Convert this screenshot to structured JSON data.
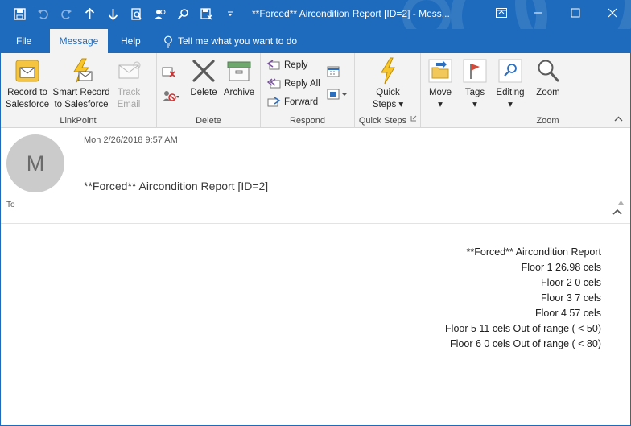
{
  "window": {
    "title": "**Forced** Aircondition Report  [ID=2]  -  Mess..."
  },
  "tabs": [
    {
      "label": "File"
    },
    {
      "label": "Message"
    },
    {
      "label": "Help"
    }
  ],
  "tell_me": "Tell me what you want to do",
  "ribbon": {
    "linkpoint": {
      "label": "LinkPoint",
      "record": [
        "Record to",
        "Salesforce"
      ],
      "smart": [
        "Smart Record",
        "to Salesforce"
      ],
      "track": [
        "Track",
        "Email"
      ]
    },
    "delete": {
      "label": "Delete",
      "delete_btn": "Delete",
      "archive_btn": "Archive"
    },
    "respond": {
      "label": "Respond",
      "reply": "Reply",
      "reply_all": "Reply All",
      "forward": "Forward"
    },
    "quicksteps": {
      "label": "Quick Steps",
      "btn": [
        "Quick",
        "Steps ▾"
      ]
    },
    "move": {
      "label": "Move"
    },
    "tags": {
      "label": "Tags"
    },
    "editing": {
      "label": "Editing"
    },
    "zoom": {
      "label": "Zoom",
      "btn": "Zoom"
    }
  },
  "message": {
    "avatar_initial": "M",
    "date": "Mon 2/26/2018 9:57 AM",
    "subject": "**Forced** Aircondition Report  [ID=2]",
    "to_label": "To",
    "body_lines": [
      "**Forced** Aircondition Report",
      "Floor 1 26.98 cels",
      "Floor 2 0 cels",
      "Floor 3 7 cels",
      "Floor 4 57 cels",
      "Floor 5 11 cels Out of range ( < 50)",
      "Floor 6 0 cels Out of range ( < 80)"
    ]
  },
  "colors": {
    "accent": "#1e6bbd",
    "ribbon_bg": "#f3f3f3",
    "avatar_bg": "#cbcbcb"
  }
}
